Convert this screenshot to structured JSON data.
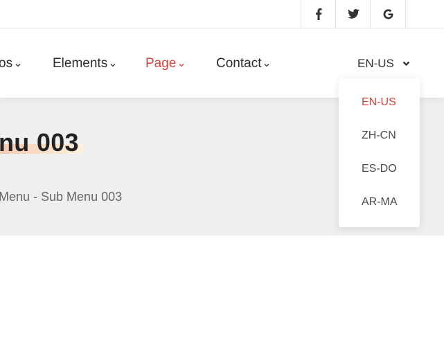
{
  "social": {
    "facebook": "facebook-icon",
    "twitter": "twitter-icon",
    "google": "google-icon"
  },
  "nav": {
    "items": [
      {
        "label": "os"
      },
      {
        "label": "Elements"
      },
      {
        "label": "Page"
      },
      {
        "label": "Contact"
      }
    ],
    "active_label": "Page",
    "language": "EN-US"
  },
  "hero": {
    "title": "nu 003",
    "breadcrumb": "Menu - Sub Menu 003"
  },
  "language_menu": {
    "options": [
      "EN-US",
      "ZH-CN",
      "ES-DO",
      "AR-MA"
    ],
    "selected": "EN-US"
  },
  "colors": {
    "accent": "#d8423a",
    "band": "#efefef"
  }
}
